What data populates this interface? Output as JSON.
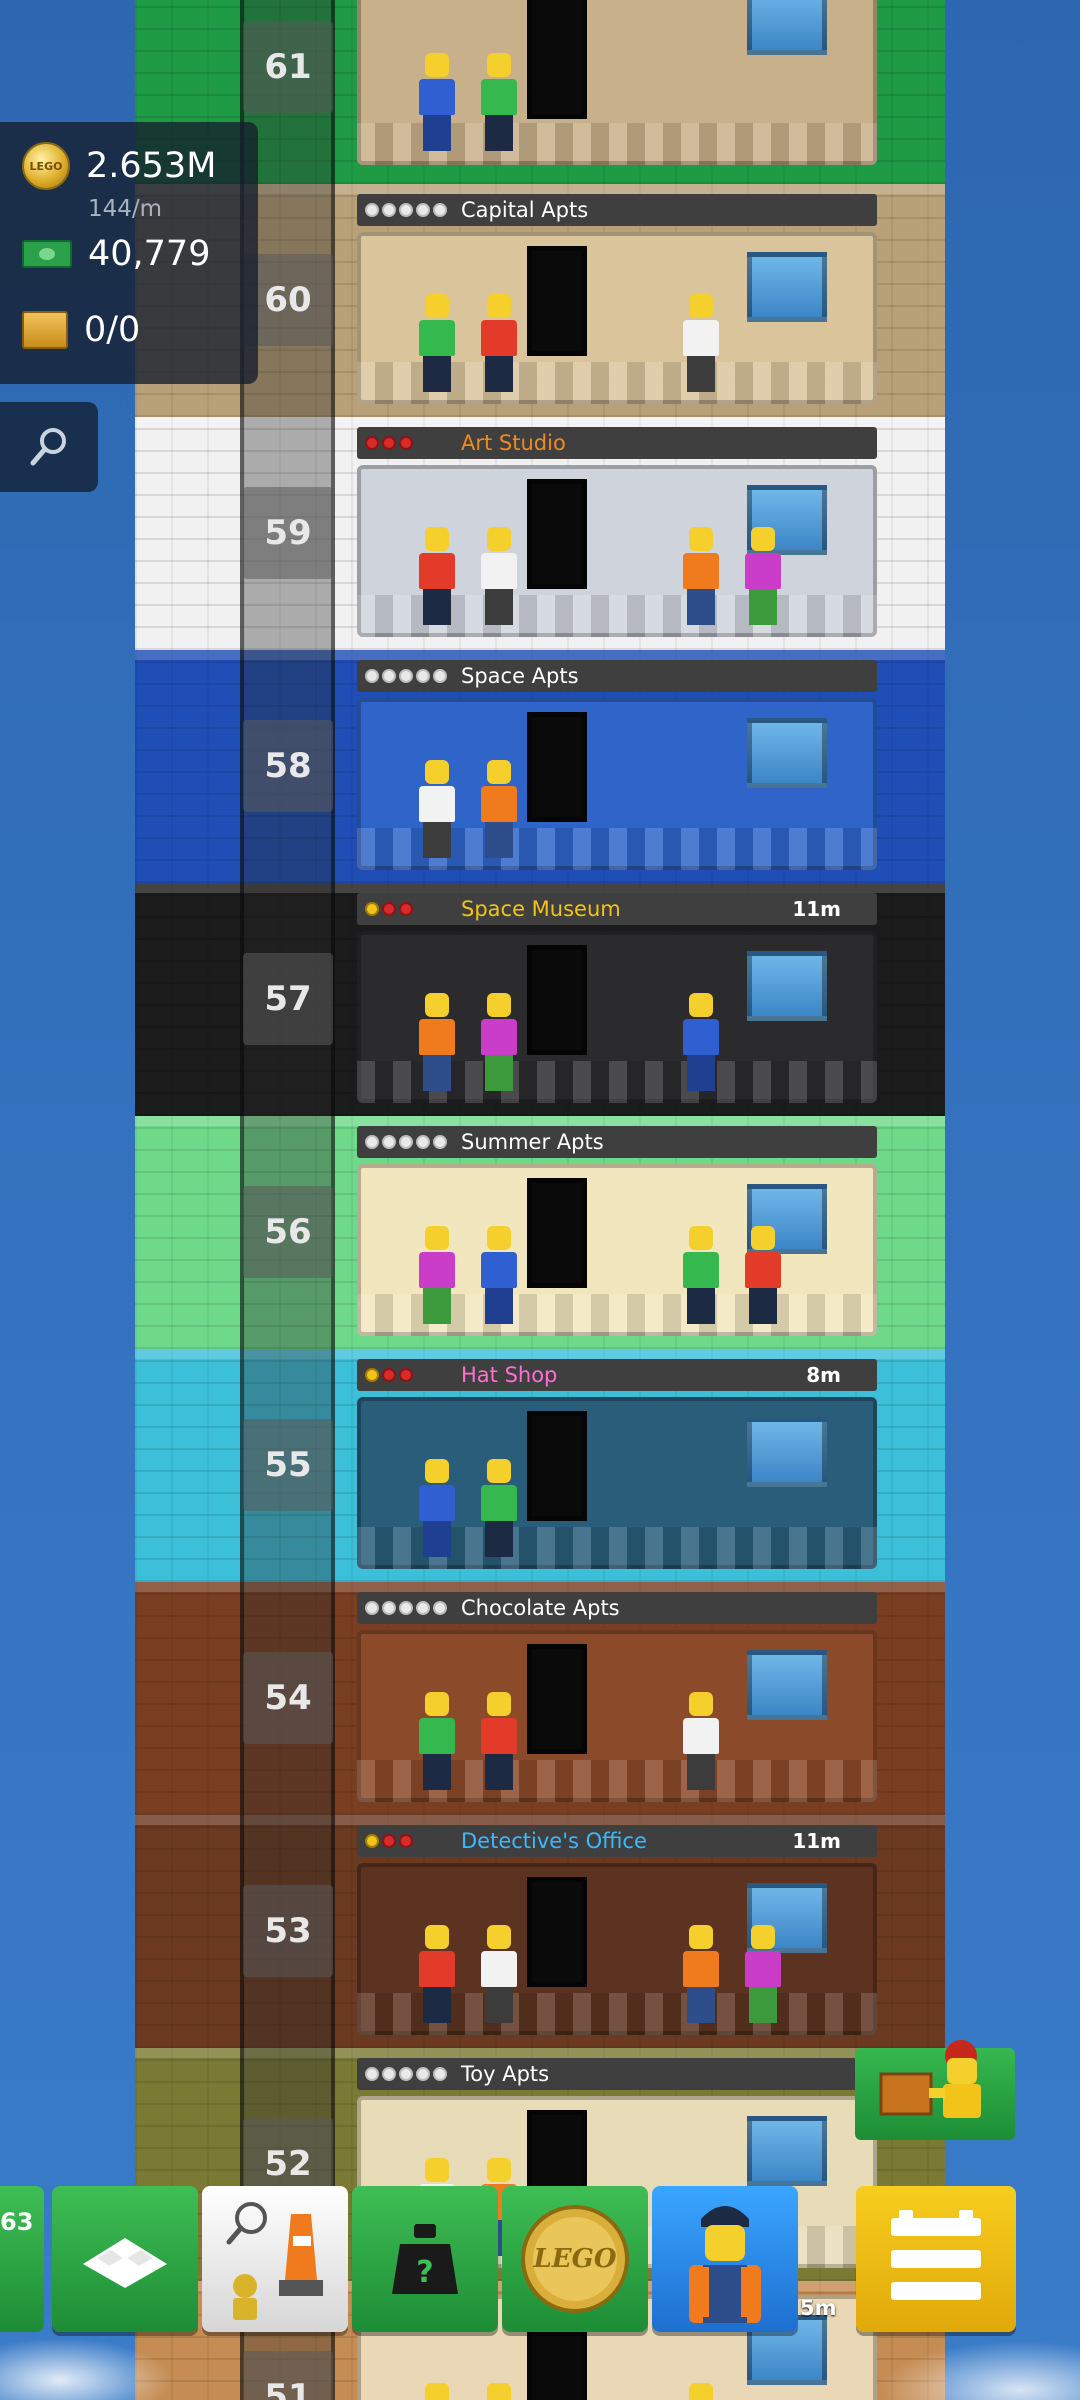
{
  "hud": {
    "coins": "2.653M",
    "coins_rate": "144/m",
    "coin_icon_text": "LEGO",
    "bux": "40,779",
    "crates": "0/0"
  },
  "icons": {
    "search": "magnifier-icon",
    "coin": "lego-coin-icon",
    "bux": "cash-icon",
    "crate": "crate-icon"
  },
  "floors": [
    {
      "number": "61",
      "label": "",
      "stars": [],
      "timer": "",
      "shell_color": "#1f9a45",
      "room_color": "#c8b08a",
      "label_color": "#ffffff"
    },
    {
      "number": "60",
      "label": "Capital Apts",
      "stars": [
        "white",
        "white",
        "white",
        "white",
        "white"
      ],
      "timer": "",
      "shell_color": "#b8a078",
      "room_color": "#d9c49c",
      "label_color": "#ffffff"
    },
    {
      "number": "59",
      "label": "Art Studio",
      "stars": [
        "red",
        "red",
        "red"
      ],
      "timer": "",
      "shell_color": "#f1f1f1",
      "room_color": "#cfd3dc",
      "label_color": "#f08a1e"
    },
    {
      "number": "58",
      "label": "Space Apts",
      "stars": [
        "white",
        "white",
        "white",
        "white",
        "white"
      ],
      "timer": "",
      "shell_color": "#1f4fb6",
      "room_color": "#2f65c9",
      "label_color": "#ffffff"
    },
    {
      "number": "57",
      "label": "Space Museum",
      "stars": [
        "gold",
        "red",
        "red"
      ],
      "timer": "11m",
      "shell_color": "#1b1b1b",
      "room_color": "#2b2b2e",
      "label_color": "#f2c318"
    },
    {
      "number": "56",
      "label": "Summer Apts",
      "stars": [
        "white",
        "white",
        "white",
        "white",
        "white"
      ],
      "timer": "",
      "shell_color": "#6fd98a",
      "room_color": "#f2e6bf",
      "label_color": "#ffffff"
    },
    {
      "number": "55",
      "label": "Hat Shop",
      "stars": [
        "gold",
        "red",
        "red"
      ],
      "timer": "8m",
      "shell_color": "#3cc0d9",
      "room_color": "#2a5d7a",
      "label_color": "#ff6fd2"
    },
    {
      "number": "54",
      "label": "Chocolate Apts",
      "stars": [
        "white",
        "white",
        "white",
        "white",
        "white"
      ],
      "timer": "",
      "shell_color": "#7a3f22",
      "room_color": "#8b4a2a",
      "label_color": "#ffffff"
    },
    {
      "number": "53",
      "label": "Detective's Office",
      "stars": [
        "gold",
        "red",
        "red"
      ],
      "timer": "11m",
      "shell_color": "#6b3a20",
      "room_color": "#5c3320",
      "label_color": "#3cb8ff"
    },
    {
      "number": "52",
      "label": "Toy Apts",
      "stars": [
        "white",
        "white",
        "white",
        "white",
        "white"
      ],
      "timer": "",
      "shell_color": "#7b7a34",
      "room_color": "#e8dcb8",
      "label_color": "#ffffff"
    },
    {
      "number": "51",
      "label": "",
      "stars": [],
      "timer": "",
      "shell_color": "#c58c54",
      "room_color": "#e9d7b5",
      "label_color": "#ffffff"
    }
  ],
  "toolbar": {
    "left_count": "63",
    "timer": "5m",
    "buttons": [
      {
        "name": "build-floor",
        "icon": "brick-icon"
      },
      {
        "name": "find-bitizen",
        "icon": "search-bitizen-icon"
      },
      {
        "name": "mystery-build",
        "icon": "mystery-icon"
      },
      {
        "name": "lego-coins-shop",
        "icon": "lego-coin-icon",
        "text": "LEGO"
      },
      {
        "name": "bitizen-portrait",
        "icon": "worker-minifig-icon"
      },
      {
        "name": "main-menu",
        "icon": "menu-icon"
      }
    ]
  }
}
